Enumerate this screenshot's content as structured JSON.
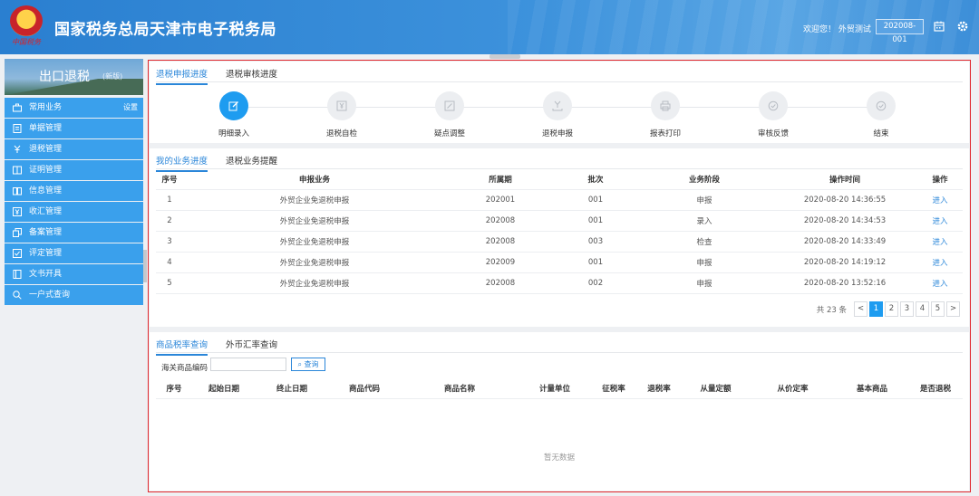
{
  "header": {
    "emblem_text": "中国税务",
    "title": "国家税务总局天津市电子税务局",
    "welcome": "欢迎您！ 外贸测试",
    "period": "202008-001"
  },
  "sidebar": {
    "banner_title": "出口退税",
    "banner_sub": "(新版)",
    "items": [
      {
        "label": "常用业务",
        "extra": "设置",
        "icon": "briefcase-icon"
      },
      {
        "label": "单据管理",
        "icon": "document-icon"
      },
      {
        "label": "退税管理",
        "icon": "yuan-return-icon"
      },
      {
        "label": "证明管理",
        "icon": "certificate-icon"
      },
      {
        "label": "信息管理",
        "icon": "book-icon"
      },
      {
        "label": "收汇管理",
        "icon": "yuan-box-icon"
      },
      {
        "label": "备案管理",
        "icon": "copy-icon"
      },
      {
        "label": "评定管理",
        "icon": "check-box-icon"
      },
      {
        "label": "文书开具",
        "icon": "file-icon"
      },
      {
        "label": "一户式查询",
        "icon": "search-icon"
      }
    ]
  },
  "progress_card": {
    "tabs": [
      {
        "label": "退税申报进度"
      },
      {
        "label": "退税审核进度"
      }
    ],
    "steps": [
      {
        "label": "明细录入"
      },
      {
        "label": "退税自检"
      },
      {
        "label": "疑点调整"
      },
      {
        "label": "退税申报"
      },
      {
        "label": "报表打印"
      },
      {
        "label": "审核反馈"
      },
      {
        "label": "结束"
      }
    ]
  },
  "business_card": {
    "tabs": [
      {
        "label": "我的业务进度"
      },
      {
        "label": "退税业务提醒"
      }
    ],
    "columns": [
      "序号",
      "申报业务",
      "所属期",
      "批次",
      "业务阶段",
      "操作时间",
      "操作"
    ],
    "rows": [
      {
        "no": "1",
        "biz": "外贸企业免退税申报",
        "period": "202001",
        "batch": "001",
        "stage": "申报",
        "time": "2020-08-20 14:36:55",
        "op": "进入"
      },
      {
        "no": "2",
        "biz": "外贸企业免退税申报",
        "period": "202008",
        "batch": "001",
        "stage": "录入",
        "time": "2020-08-20 14:34:53",
        "op": "进入"
      },
      {
        "no": "3",
        "biz": "外贸企业免退税申报",
        "period": "202008",
        "batch": "003",
        "stage": "检查",
        "time": "2020-08-20 14:33:49",
        "op": "进入"
      },
      {
        "no": "4",
        "biz": "外贸企业免退税申报",
        "period": "202009",
        "batch": "001",
        "stage": "申报",
        "time": "2020-08-20 14:19:12",
        "op": "进入"
      },
      {
        "no": "5",
        "biz": "外贸企业免退税申报",
        "period": "202008",
        "batch": "002",
        "stage": "申报",
        "time": "2020-08-20 13:52:16",
        "op": "进入"
      }
    ],
    "pager": {
      "total": "共 23 条",
      "prev": "<",
      "pages": [
        "1",
        "2",
        "3",
        "4",
        "5"
      ],
      "next": ">",
      "active": "1"
    }
  },
  "rate_card": {
    "tabs": [
      {
        "label": "商品税率查询"
      },
      {
        "label": "外币汇率查询"
      }
    ],
    "search_label": "海关商品编码",
    "search_value": "",
    "search_button": "查询",
    "columns": [
      "序号",
      "起始日期",
      "终止日期",
      "商品代码",
      "商品名称",
      "计量单位",
      "征税率",
      "退税率",
      "从量定额",
      "从价定率",
      "基本商品",
      "是否退税"
    ],
    "empty_text": "暂无数据"
  },
  "colors": {
    "accent": "#1e9cf0",
    "menu": "#3aa0ec",
    "frame": "#e0272d"
  }
}
